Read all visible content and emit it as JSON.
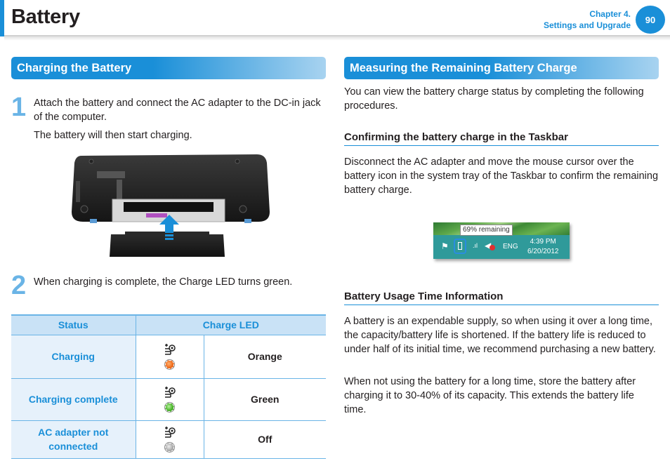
{
  "header": {
    "title": "Battery",
    "chapter_line1": "Chapter 4.",
    "chapter_line2": "Settings and Upgrade",
    "page_number": "90",
    "accent_color": "#1a8fd8"
  },
  "left": {
    "section_title": "Charging the Battery",
    "steps": [
      {
        "number": "1",
        "text": "Attach the battery and connect the AC adapter to the DC-in jack of the computer.",
        "subtext": "The battery will then start charging."
      },
      {
        "number": "2",
        "text": "When charging is complete, the Charge LED turns green."
      }
    ],
    "figure_label": "laptop-battery-insertion-illustration",
    "table": {
      "headers": [
        "Status",
        "Charge LED"
      ],
      "rows": [
        {
          "status": "Charging",
          "icon": "charge-led-icon",
          "led": "orange-led",
          "color": "Orange"
        },
        {
          "status": "Charging complete",
          "icon": "charge-led-icon",
          "led": "green-led",
          "color": "Green"
        },
        {
          "status": "AC adapter not connected",
          "icon": "charge-led-icon",
          "led": "off-led",
          "color": "Off"
        }
      ]
    }
  },
  "right": {
    "section_title": "Measuring the Remaining Battery Charge",
    "intro": "You can view the battery charge status by completing the following procedures.",
    "subsections": [
      {
        "title": "Confirming the battery charge in the Taskbar",
        "paragraphs": [
          "Disconnect the AC adapter and move the mouse cursor over the battery icon in the system tray of the Taskbar to confirm the remaining battery charge."
        ]
      },
      {
        "title": "Battery Usage Time Information",
        "paragraphs": [
          "A battery is an expendable supply, so when using it over a long time, the capacity/battery life is shortened. If the battery life is reduced to under half of its initial time, we recommend purchasing a new battery.",
          "When not using the battery for a long time, store the battery after charging it to 30-40% of its capacity. This extends the battery life time."
        ]
      }
    ],
    "taskbar": {
      "tooltip": "69% remaining",
      "language": "ENG",
      "time": "4:39 PM",
      "date": "6/20/2012"
    }
  }
}
